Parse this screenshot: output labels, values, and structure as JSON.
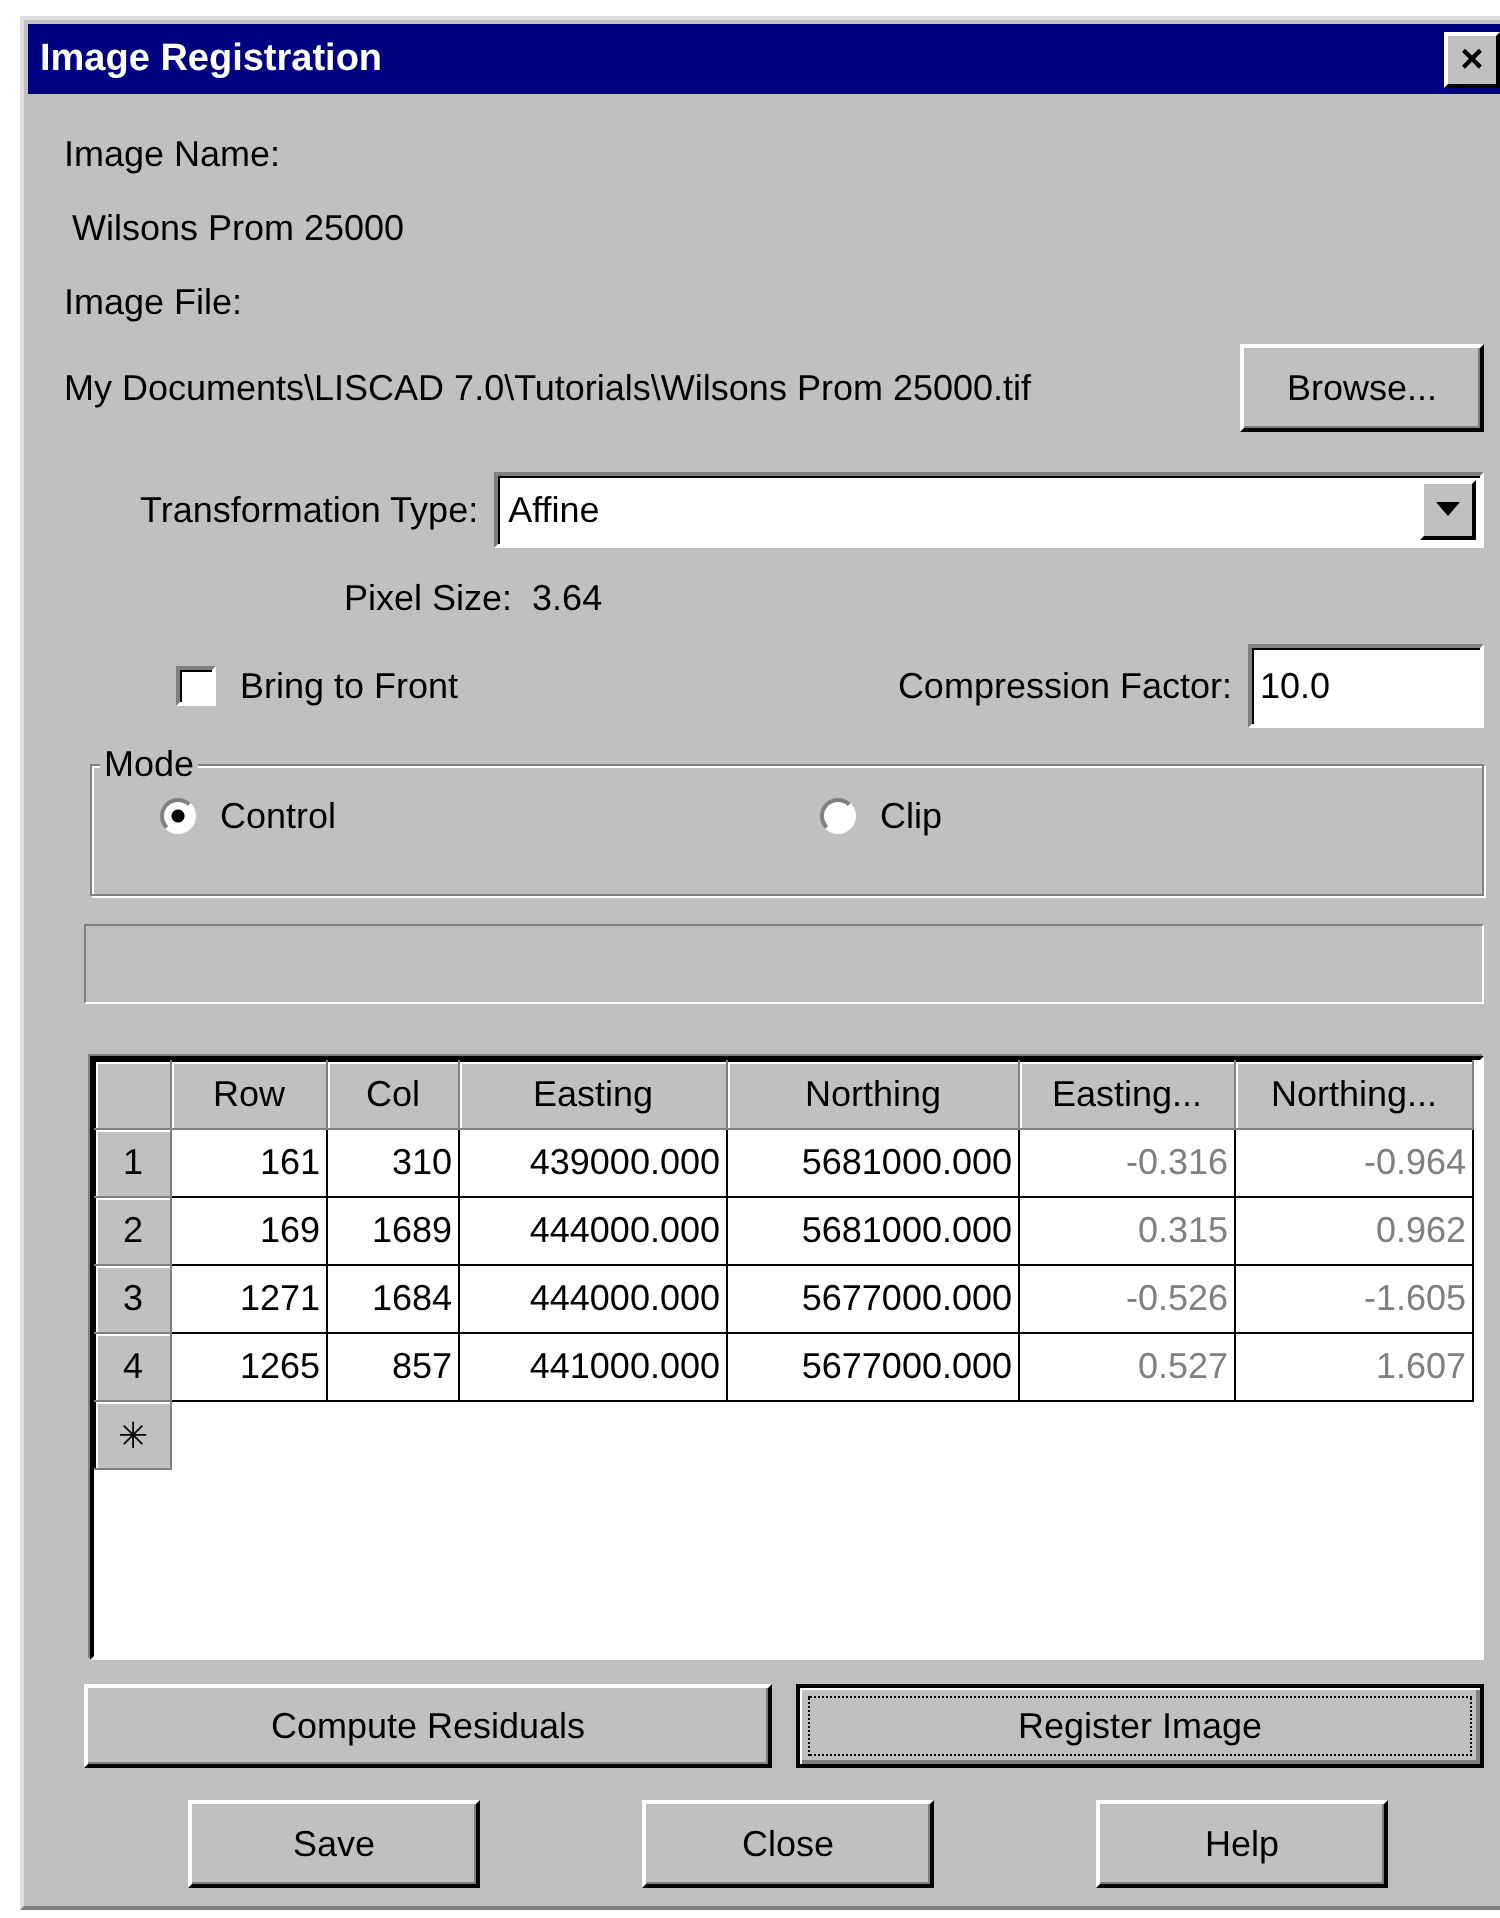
{
  "window": {
    "title": "Image Registration",
    "close": "×"
  },
  "image_name": {
    "label": "Image Name:",
    "value": "Wilsons Prom 25000"
  },
  "image_file": {
    "label": "Image File:",
    "value": "My Documents\\LISCAD 7.0\\Tutorials\\Wilsons Prom 25000.tif",
    "button": "Browse..."
  },
  "transformation_type": {
    "label": "Transformation Type:",
    "value": "Affine"
  },
  "pixel_size": {
    "label": "Pixel Size:",
    "value": "3.64"
  },
  "bring_to_front": {
    "label": "Bring to Front",
    "checked": false
  },
  "compression_factor": {
    "label": "Compression Factor:",
    "value": "10.0"
  },
  "mode": {
    "label": "Mode",
    "options": [
      {
        "label": "Control",
        "selected": true
      },
      {
        "label": "Clip",
        "selected": false
      }
    ]
  },
  "table": {
    "columns": [
      {
        "label": "Row",
        "readonly": false
      },
      {
        "label": "Col",
        "readonly": false
      },
      {
        "label": "Easting",
        "readonly": false
      },
      {
        "label": "Northing",
        "readonly": false
      },
      {
        "label": "Easting...",
        "readonly": true
      },
      {
        "label": "Northing...",
        "readonly": true
      }
    ],
    "rows": [
      {
        "header": "1",
        "cells": [
          "161",
          "310",
          "439000.000",
          "5681000.000",
          "-0.316",
          "-0.964"
        ]
      },
      {
        "header": "2",
        "cells": [
          "169",
          "1689",
          "444000.000",
          "5681000.000",
          "0.315",
          "0.962"
        ]
      },
      {
        "header": "3",
        "cells": [
          "1271",
          "1684",
          "444000.000",
          "5677000.000",
          "-0.526",
          "-1.605"
        ]
      },
      {
        "header": "4",
        "cells": [
          "1265",
          "857",
          "441000.000",
          "5677000.000",
          "0.527",
          "1.607"
        ]
      }
    ],
    "new_row_marker": "✳"
  },
  "action_buttons": [
    {
      "label": "Compute Residuals",
      "focused": false
    },
    {
      "label": "Register Image",
      "focused": true
    }
  ],
  "dialog_buttons": [
    "Save",
    "Close",
    "Help"
  ]
}
